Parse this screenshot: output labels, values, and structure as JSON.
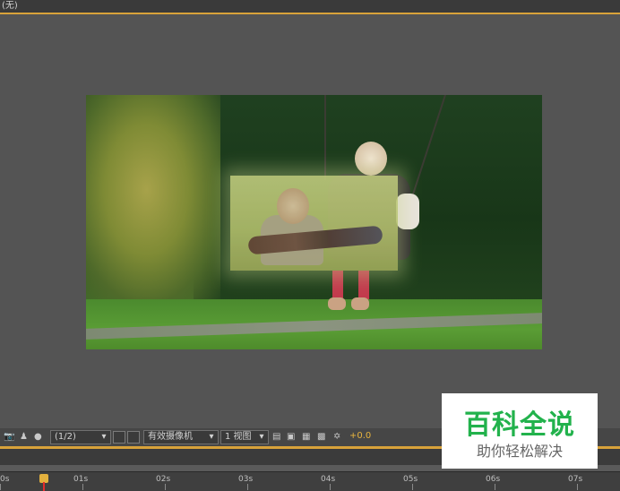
{
  "top_bar": {
    "label": "(无)"
  },
  "toolbar": {
    "resolution": "(1/2)",
    "camera": "有效摄像机",
    "views": "1 视图",
    "exposure": "+0.0"
  },
  "timeline": {
    "ticks": [
      "0s",
      "01s",
      "02s",
      "03s",
      "04s",
      "05s",
      "06s",
      "07s"
    ]
  },
  "watermark": {
    "title": "百科全说",
    "subtitle": "助你轻松解决"
  }
}
